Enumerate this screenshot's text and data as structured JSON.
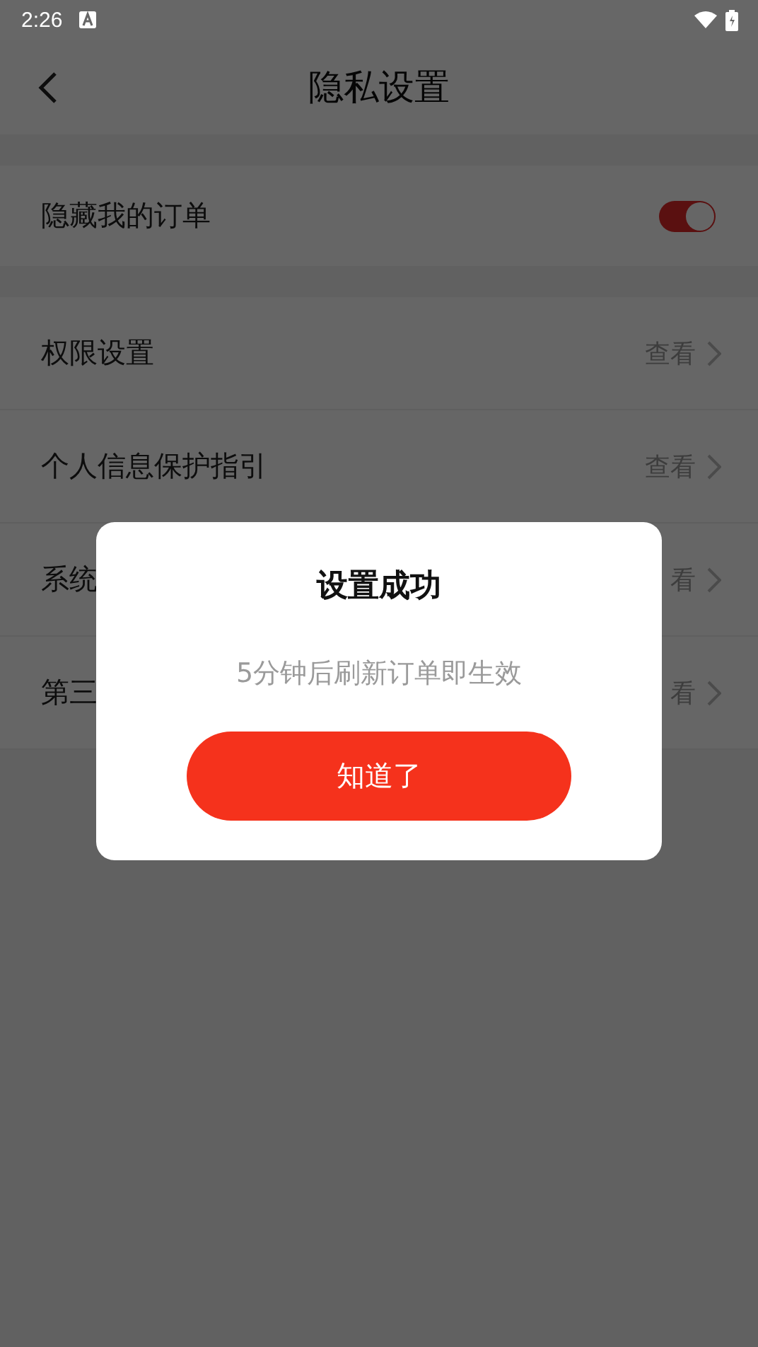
{
  "status_bar": {
    "time": "2:26"
  },
  "header": {
    "title": "隐私设置"
  },
  "toggle_row": {
    "label": "隐藏我的订单",
    "on": true
  },
  "rows": [
    {
      "label": "权限设置",
      "action": "查看"
    },
    {
      "label": "个人信息保护指引",
      "action": "查看"
    },
    {
      "label": "系统",
      "action": "看"
    },
    {
      "label": "第三",
      "action": "看"
    }
  ],
  "dialog": {
    "title": "设置成功",
    "message": "5分钟后刷新订单即生效",
    "button": "知道了"
  }
}
